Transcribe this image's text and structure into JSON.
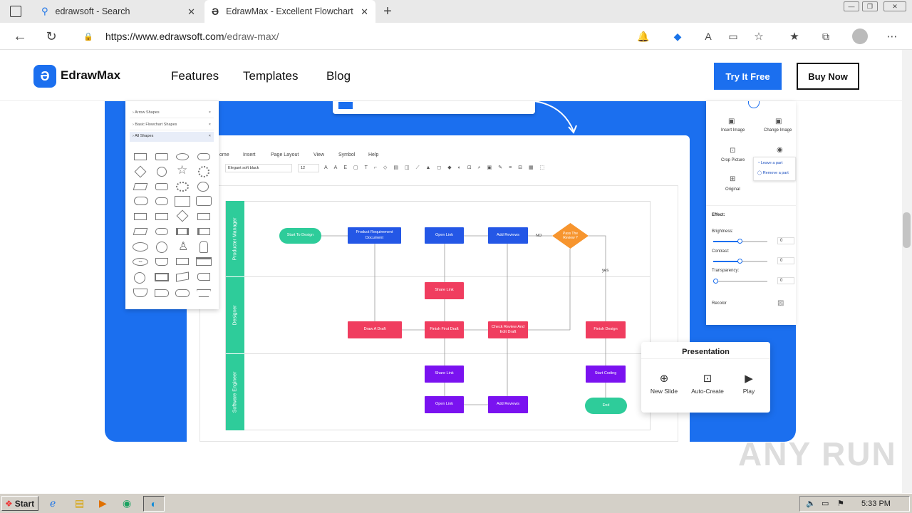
{
  "browser": {
    "tabs": [
      {
        "title": "edrawsoft - Search"
      },
      {
        "title": "EdrawMax - Excellent Flowchart S"
      }
    ],
    "url": "https://www.edrawsoft.com/edraw-max/",
    "url_host": "https://www.edrawsoft.com",
    "url_path": "/edraw-max/"
  },
  "site": {
    "logo_text": "EdrawMax",
    "nav": [
      "Features",
      "Templates",
      "Blog"
    ],
    "cta_primary": "Try It Free",
    "cta_secondary": "Buy Now"
  },
  "editor": {
    "menu": [
      "ome",
      "Insert",
      "Page Layout",
      "View",
      "Symbol",
      "Help"
    ],
    "font_name": "Elegant soft black",
    "font_size": "12"
  },
  "shape_library": {
    "categories": [
      "Arrow Shapes",
      "Basic Flowchart Shapes",
      "All Shapes"
    ]
  },
  "swimlanes": [
    "Producter Manager",
    "Designer",
    "Software Engineer"
  ],
  "flow_nodes": {
    "start": "Start To Design",
    "prd": "Product Requirement Document",
    "open_link_1": "Open Link",
    "add_reviews_1": "Add Reviews",
    "decision": "Pass The Review ?",
    "no": "NO",
    "yes": "yes",
    "share_link_1": "Share Link",
    "draw_draft": "Draw A Draft",
    "finish_draft": "Finish First Draft",
    "check_review": "Check Review And Edit Draft",
    "finish_design": "Finish Design",
    "share_link_2": "Share Link",
    "start_coding": "Start Coding",
    "open_link_2": "Open Link",
    "add_reviews_2": "Add Reviews",
    "end": "End"
  },
  "image_panel": {
    "actions": [
      "Insert Image",
      "Change Image",
      "Crop Picture",
      "Original"
    ],
    "popup": [
      "Leave a part",
      "Remove a part"
    ],
    "effect_label": "Effect:",
    "brightness_label": "Brightness:",
    "contrast_label": "Contrast:",
    "transparency_label": "Transparency:",
    "recolor_label": "Recolor",
    "value_brightness": "0",
    "value_contrast": "0",
    "value_transparency": "0"
  },
  "presentation": {
    "title": "Presentation",
    "items": [
      "New Slide",
      "Auto-Create",
      "Play"
    ]
  },
  "watermark": "ANY RUN",
  "taskbar": {
    "start": "Start",
    "clock": "5:33 PM"
  },
  "colors": {
    "brand_blue": "#1b6fef",
    "lane_green": "#2ecc9a",
    "node_blue": "#2457e6",
    "node_red": "#f03d5f",
    "node_purple": "#7a12f0",
    "decision_orange": "#f7952e"
  }
}
